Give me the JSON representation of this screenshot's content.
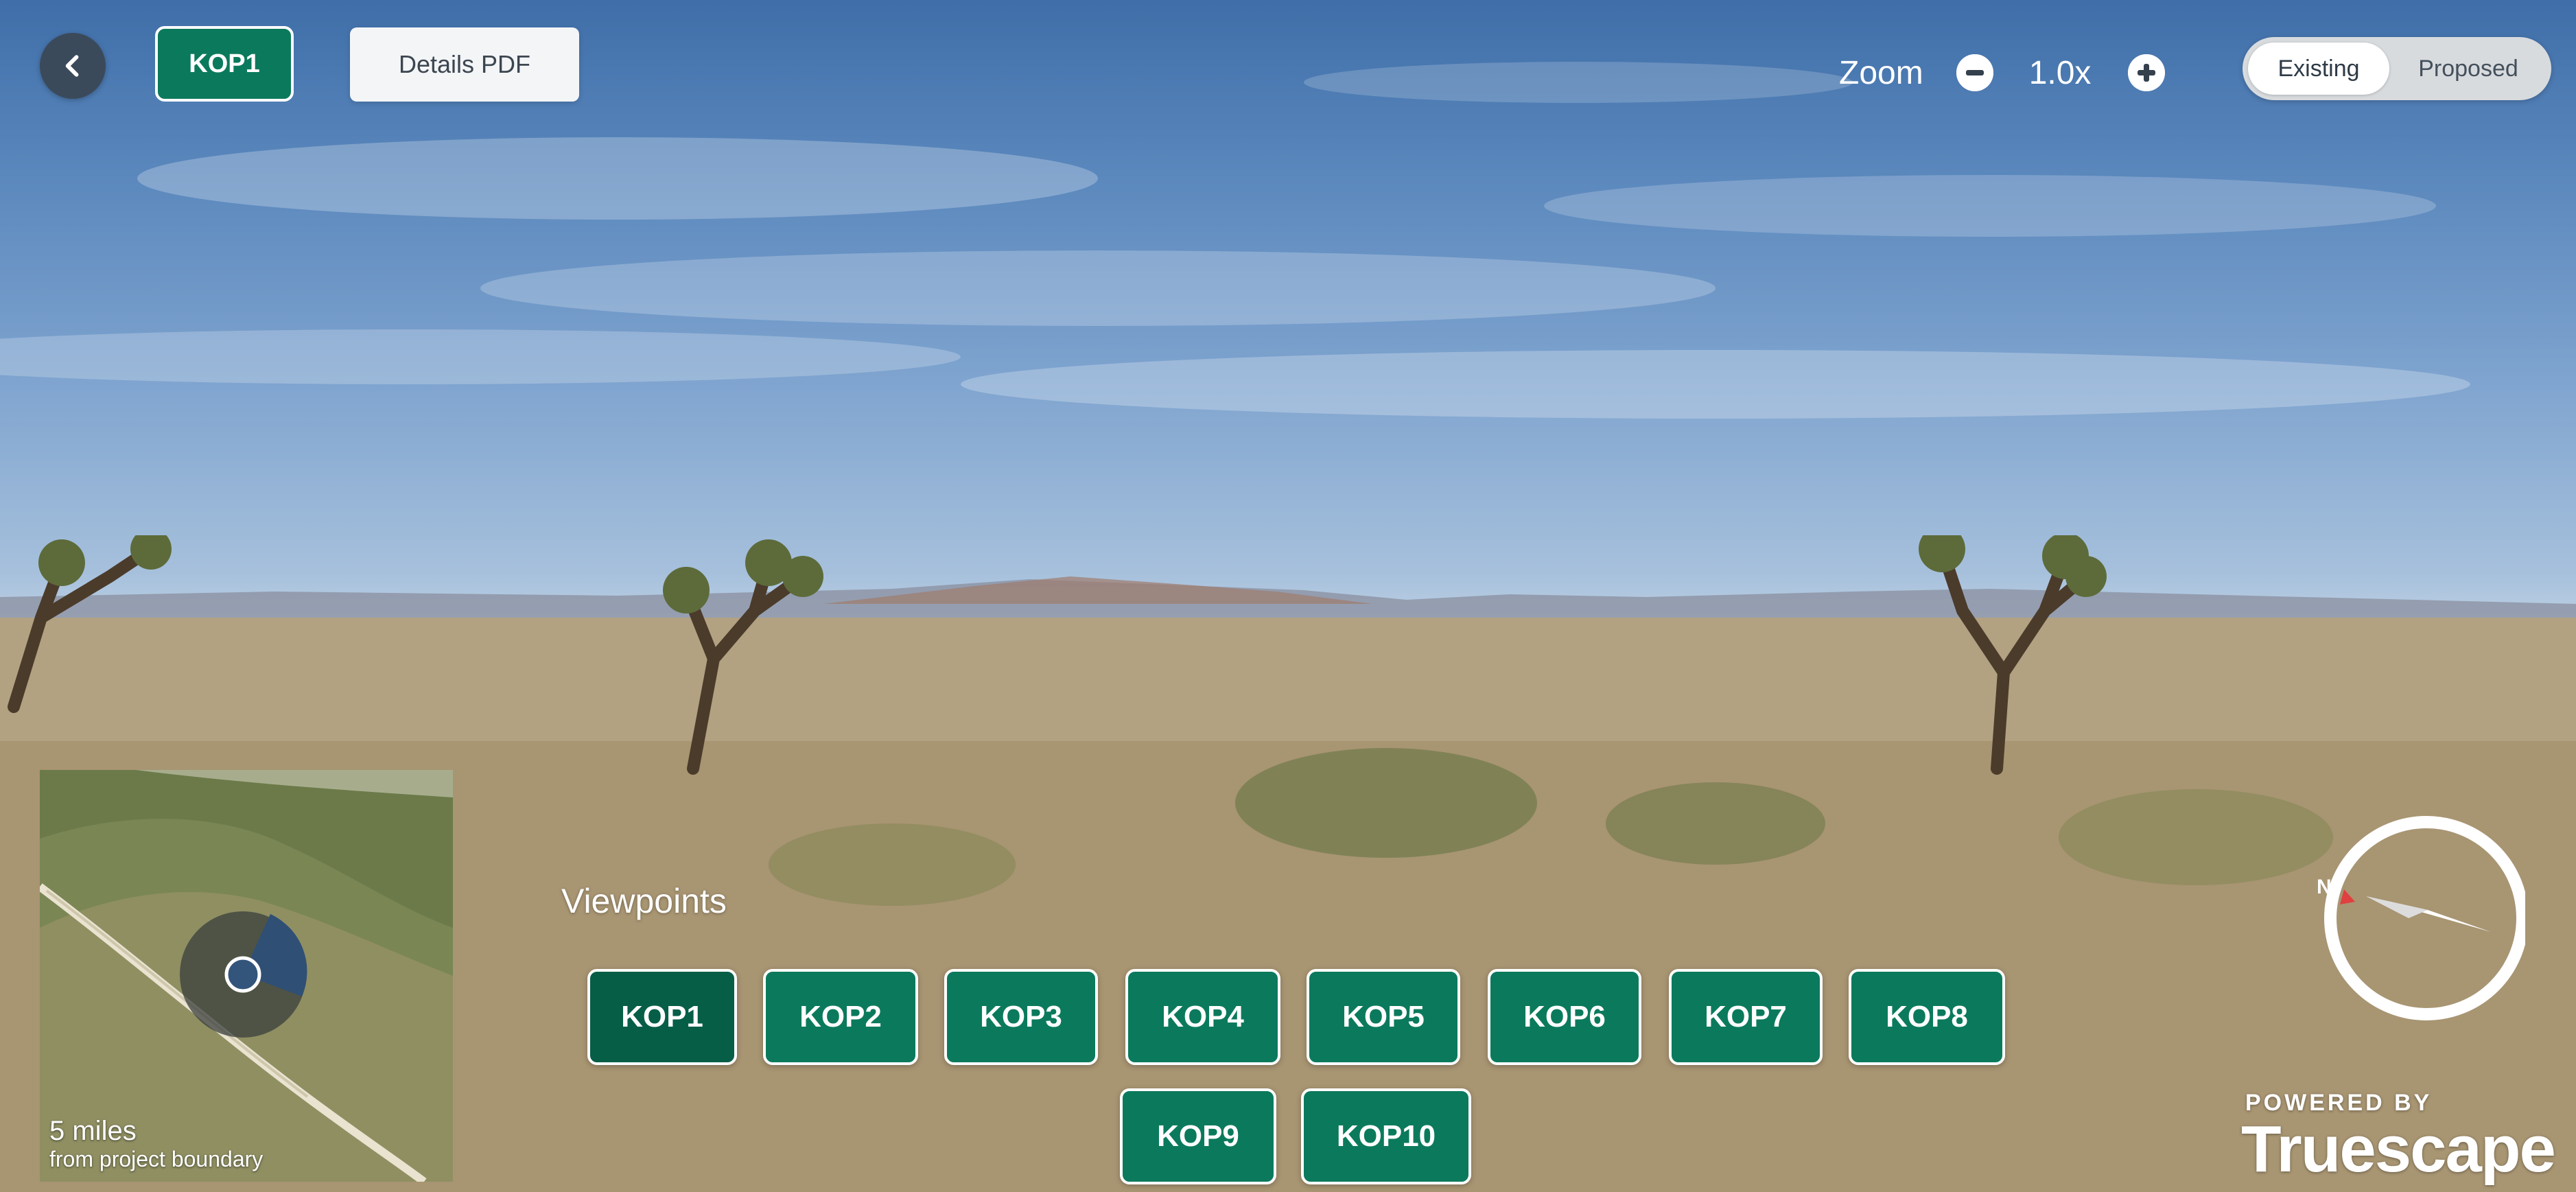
{
  "toolbar": {
    "current_viewpoint": "KOP1",
    "details_label": "Details PDF",
    "back_icon": "chevron-left-icon"
  },
  "zoom": {
    "label": "Zoom",
    "value": "1.0x",
    "minus_icon": "minus-circle-icon",
    "plus_icon": "plus-circle-icon"
  },
  "view_toggle": {
    "options": [
      "Existing",
      "Proposed"
    ],
    "selected": "Existing"
  },
  "minimap": {
    "distance": "5 miles",
    "subtitle": "from project boundary"
  },
  "viewpoints": {
    "heading": "Viewpoints",
    "items": [
      "KOP1",
      "KOP2",
      "KOP3",
      "KOP4",
      "KOP5",
      "KOP6",
      "KOP7",
      "KOP8",
      "KOP9",
      "KOP10"
    ],
    "active": "KOP1"
  },
  "compass": {
    "north_label": "N"
  },
  "brand": {
    "powered_by": "POWERED BY",
    "name": "Truescape"
  },
  "colors": {
    "accent_green": "#0b7a5c",
    "active_green": "#065e47",
    "back_button": "#3b4a5a"
  }
}
